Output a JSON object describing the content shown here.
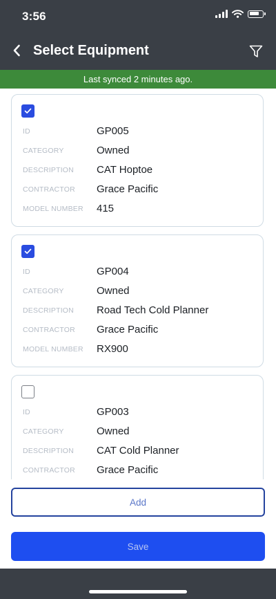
{
  "status_bar": {
    "time": "3:56"
  },
  "header": {
    "title": "Select Equipment"
  },
  "sync_banner": {
    "text": "Last synced 2 minutes ago."
  },
  "field_labels": {
    "id": "ID",
    "category": "CATEGORY",
    "description": "DESCRIPTION",
    "contractor": "CONTRACTOR",
    "model_number": "MODEL NUMBER"
  },
  "equipment": [
    {
      "checked": true,
      "id": "GP005",
      "category": "Owned",
      "description": "CAT Hoptoe",
      "contractor": "Grace Pacific",
      "model_number": "415"
    },
    {
      "checked": true,
      "id": "GP004",
      "category": "Owned",
      "description": "Road Tech Cold Planner",
      "contractor": "Grace Pacific",
      "model_number": "RX900"
    },
    {
      "checked": false,
      "id": "GP003",
      "category": "Owned",
      "description": "CAT Cold Planner",
      "contractor": "Grace Pacific"
    }
  ],
  "actions": {
    "add_label": "Add",
    "save_label": "Save"
  },
  "colors": {
    "header_bg": "#3a3f46",
    "sync_green": "#3d8a3a",
    "primary_blue": "#1e4ef0",
    "checkbox_blue": "#2a4ce0"
  },
  "icons": {
    "back": "chevron-left-icon",
    "filter": "filter-icon",
    "check": "checkmark-icon"
  }
}
